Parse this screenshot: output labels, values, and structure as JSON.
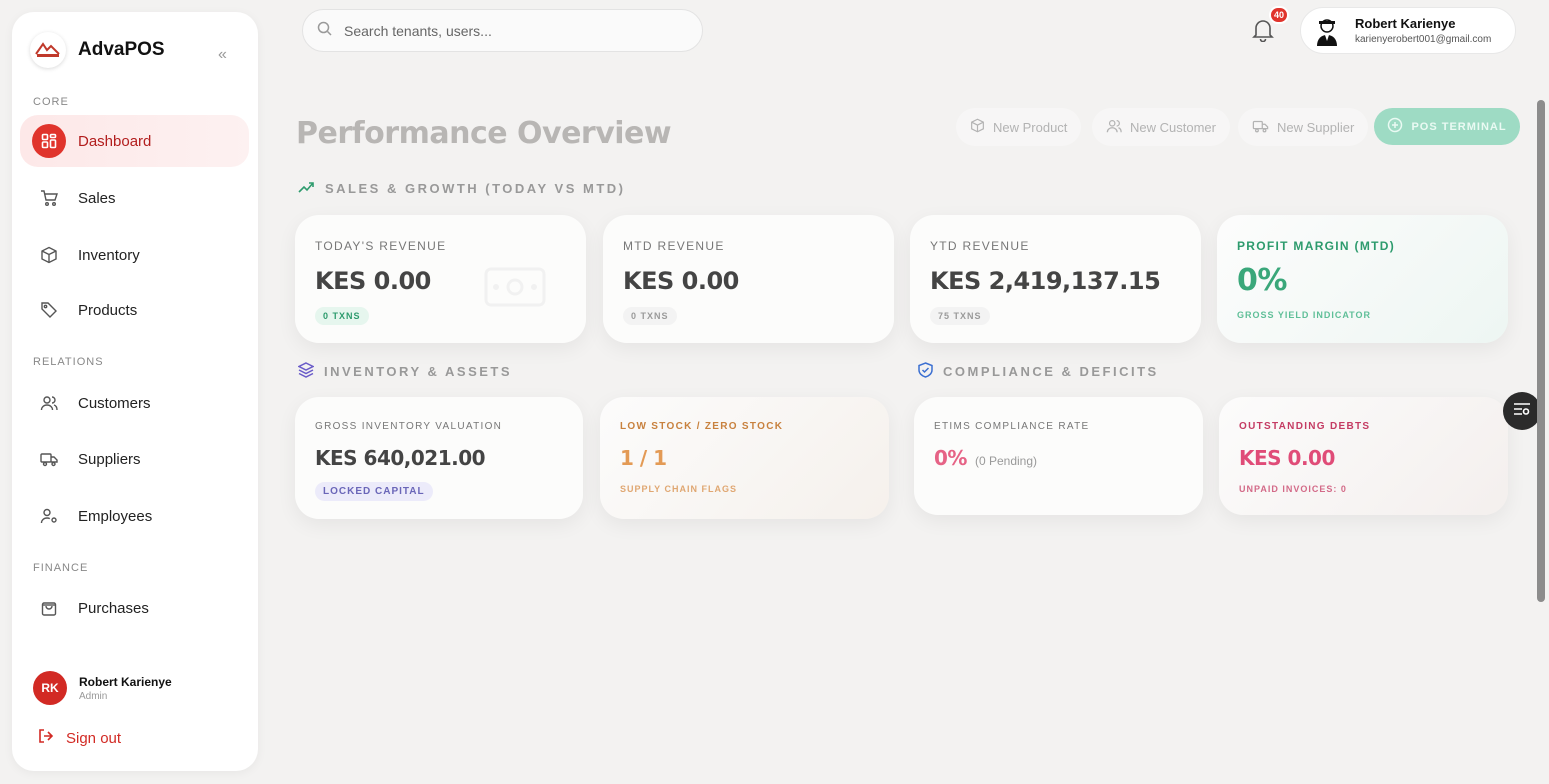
{
  "brand": {
    "name": "AdvaPOS",
    "logo_text": "AdvaPOS"
  },
  "sidebar": {
    "sections": {
      "core": "CORE",
      "relations": "RELATIONS",
      "finance": "FINANCE"
    },
    "items": [
      {
        "label": "Dashboard",
        "icon": "dashboard-icon"
      },
      {
        "label": "Sales",
        "icon": "cart-icon"
      },
      {
        "label": "Inventory",
        "icon": "box-icon"
      },
      {
        "label": "Products",
        "icon": "tag-icon"
      },
      {
        "label": "Customers",
        "icon": "users-icon"
      },
      {
        "label": "Suppliers",
        "icon": "truck-icon"
      },
      {
        "label": "Employees",
        "icon": "user-cog-icon"
      },
      {
        "label": "Purchases",
        "icon": "bag-icon"
      }
    ],
    "user": {
      "initials": "RK",
      "name": "Robert Karienye",
      "role": "Admin"
    },
    "signout": "Sign out"
  },
  "header": {
    "search_placeholder": "Search tenants, users...",
    "notifications_count": "40",
    "profile": {
      "name": "Robert Karienye",
      "email": "karienyerobert001@gmail.com"
    }
  },
  "page": {
    "title": "Performance Overview",
    "actions": {
      "new_product": "New Product",
      "new_customer": "New Customer",
      "new_supplier": "New Supplier",
      "pos_terminal": "POS TERMINAL"
    }
  },
  "sections": {
    "sales": "SALES & GROWTH (TODAY VS MTD)",
    "inventory": "INVENTORY & ASSETS",
    "compliance": "COMPLIANCE & DEFICITS"
  },
  "cards": {
    "today": {
      "label": "TODAY'S REVENUE",
      "value": "KES 0.00",
      "pill": "0 TXNS"
    },
    "mtd": {
      "label": "MTD REVENUE",
      "value": "KES 0.00",
      "pill": "0 TXNS"
    },
    "ytd": {
      "label": "YTD REVENUE",
      "value": "KES 2,419,137.15",
      "pill": "75 TXNS"
    },
    "margin": {
      "label": "PROFIT MARGIN (MTD)",
      "value": "0%",
      "note": "GROSS YIELD INDICATOR"
    },
    "inventory": {
      "label": "GROSS INVENTORY VALUATION",
      "value": "KES 640,021.00",
      "pill": "LOCKED CAPITAL"
    },
    "stock": {
      "label": "LOW STOCK / ZERO STOCK",
      "value": "1 / 1",
      "note": "SUPPLY CHAIN FLAGS"
    },
    "etims": {
      "label": "ETIMS COMPLIANCE RATE",
      "value": "0%",
      "pending": "(0 Pending)"
    },
    "debts": {
      "label": "OUTSTANDING DEBTS",
      "value": "KES 0.00",
      "note": "UNPAID INVOICES: 0"
    }
  },
  "colors": {
    "accent": "#e0342c",
    "green": "#2d9b6d",
    "orange": "#d8893f",
    "pink": "#e04c78"
  }
}
